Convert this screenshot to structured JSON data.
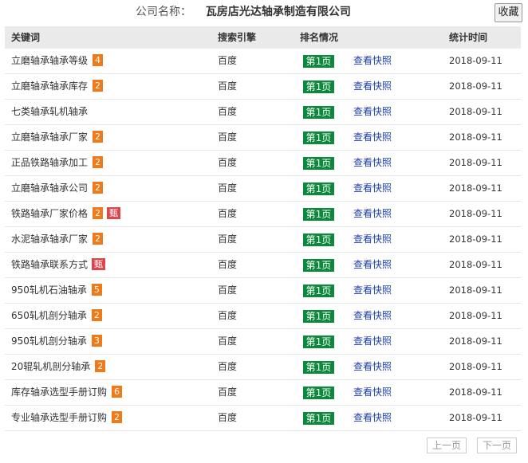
{
  "company": {
    "label": "公司名称：",
    "name": "瓦房店光达轴承制造有限公司"
  },
  "favorite_label": "收藏",
  "headers": {
    "keyword": "关键词",
    "engine": "搜索引擎",
    "rank": "排名情况",
    "date": "统计时间"
  },
  "rows": [
    {
      "keyword": "立磨轴承轴承等级",
      "badge": "4",
      "flag": "",
      "engine": "百度",
      "rank": "第1页",
      "snapshot": "查看快照",
      "date": "2018-09-11"
    },
    {
      "keyword": "立磨轴承轴承库存",
      "badge": "2",
      "flag": "",
      "engine": "百度",
      "rank": "第1页",
      "snapshot": "查看快照",
      "date": "2018-09-11"
    },
    {
      "keyword": "七类轴承轧机轴承",
      "badge": "",
      "flag": "",
      "engine": "百度",
      "rank": "第1页",
      "snapshot": "查看快照",
      "date": "2018-09-11"
    },
    {
      "keyword": "立磨轴承轴承厂家",
      "badge": "2",
      "flag": "",
      "engine": "百度",
      "rank": "第1页",
      "snapshot": "查看快照",
      "date": "2018-09-11"
    },
    {
      "keyword": "正品铁路轴承加工",
      "badge": "2",
      "flag": "",
      "engine": "百度",
      "rank": "第1页",
      "snapshot": "查看快照",
      "date": "2018-09-11"
    },
    {
      "keyword": "立磨轴承轴承公司",
      "badge": "2",
      "flag": "",
      "engine": "百度",
      "rank": "第1页",
      "snapshot": "查看快照",
      "date": "2018-09-11"
    },
    {
      "keyword": "铁路轴承厂家价格",
      "badge": "2",
      "flag": "甄",
      "engine": "百度",
      "rank": "第1页",
      "snapshot": "查看快照",
      "date": "2018-09-11"
    },
    {
      "keyword": "水泥轴承轴承厂家",
      "badge": "2",
      "flag": "",
      "engine": "百度",
      "rank": "第1页",
      "snapshot": "查看快照",
      "date": "2018-09-11"
    },
    {
      "keyword": "铁路轴承联系方式",
      "badge": "",
      "flag": "甄",
      "engine": "百度",
      "rank": "第1页",
      "snapshot": "查看快照",
      "date": "2018-09-11"
    },
    {
      "keyword": "950轧机石油轴承",
      "badge": "5",
      "flag": "",
      "engine": "百度",
      "rank": "第1页",
      "snapshot": "查看快照",
      "date": "2018-09-11"
    },
    {
      "keyword": "650轧机剖分轴承",
      "badge": "2",
      "flag": "",
      "engine": "百度",
      "rank": "第1页",
      "snapshot": "查看快照",
      "date": "2018-09-11"
    },
    {
      "keyword": "950轧机剖分轴承",
      "badge": "3",
      "flag": "",
      "engine": "百度",
      "rank": "第1页",
      "snapshot": "查看快照",
      "date": "2018-09-11"
    },
    {
      "keyword": "20辊轧机剖分轴承",
      "badge": "2",
      "flag": "",
      "engine": "百度",
      "rank": "第1页",
      "snapshot": "查看快照",
      "date": "2018-09-11"
    },
    {
      "keyword": "库存轴承选型手册订购",
      "badge": "6",
      "flag": "",
      "engine": "百度",
      "rank": "第1页",
      "snapshot": "查看快照",
      "date": "2018-09-11"
    },
    {
      "keyword": "专业轴承选型手册订购",
      "badge": "2",
      "flag": "",
      "engine": "百度",
      "rank": "第1页",
      "snapshot": "查看快照",
      "date": "2018-09-11"
    }
  ],
  "pager": {
    "prev": "上一页",
    "next": "下一页"
  },
  "colors": {
    "rank_bg": "#0a8a3a",
    "badge_orange": "#f07a1a",
    "badge_red": "#d9474d",
    "link": "#1b3ea8",
    "header_bg": "#eaeaea"
  }
}
